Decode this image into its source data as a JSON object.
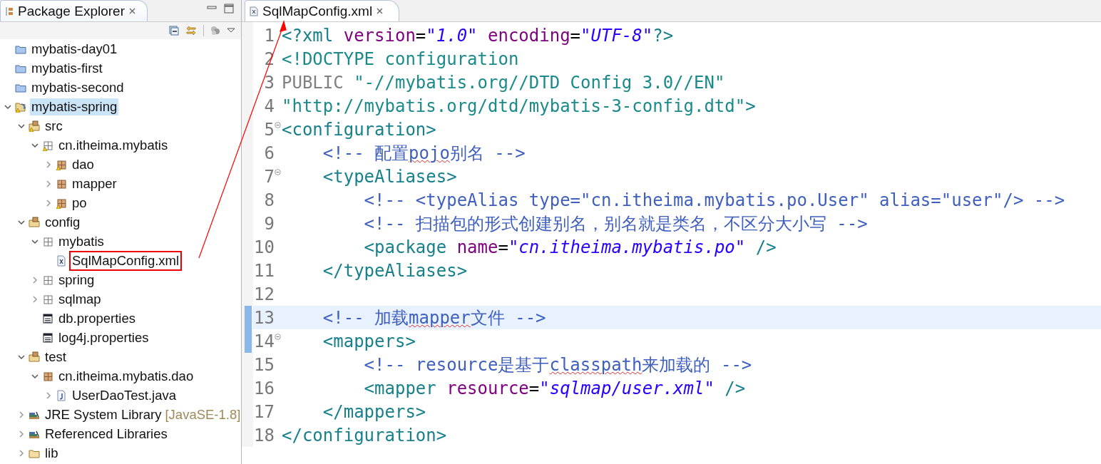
{
  "explorer": {
    "title": "Package Explorer",
    "tree": [
      {
        "label": "mybatis-day01",
        "kind": "project_closed"
      },
      {
        "label": "mybatis-first",
        "kind": "project_closed"
      },
      {
        "label": "mybatis-second",
        "kind": "project_closed"
      },
      {
        "label": "mybatis-spring",
        "kind": "project_open",
        "warning": true,
        "selected": true,
        "expanded": true,
        "children": [
          {
            "label": "src",
            "kind": "source_folder",
            "warning": true,
            "expanded": true,
            "children": [
              {
                "label": "cn.itheima.mybatis",
                "kind": "package_empty",
                "warning": true,
                "expanded": true,
                "children": [
                  {
                    "label": "dao",
                    "kind": "package",
                    "warning": true,
                    "expanded": false
                  },
                  {
                    "label": "mapper",
                    "kind": "package",
                    "expanded": false
                  },
                  {
                    "label": "po",
                    "kind": "package",
                    "warning": true,
                    "expanded": false
                  }
                ]
              }
            ]
          },
          {
            "label": "config",
            "kind": "source_folder",
            "expanded": true,
            "children": [
              {
                "label": "mybatis",
                "kind": "package_empty",
                "expanded": true,
                "children": [
                  {
                    "label": "SqlMapConfig.xml",
                    "kind": "file_xml",
                    "annotated": true
                  }
                ]
              },
              {
                "label": "spring",
                "kind": "package_empty",
                "expanded": false
              },
              {
                "label": "sqlmap",
                "kind": "package_empty",
                "expanded": false
              },
              {
                "label": "db.properties",
                "kind": "file_properties"
              },
              {
                "label": "log4j.properties",
                "kind": "file_properties"
              }
            ]
          },
          {
            "label": "test",
            "kind": "source_folder",
            "expanded": true,
            "children": [
              {
                "label": "cn.itheima.mybatis.dao",
                "kind": "package",
                "expanded": true,
                "children": [
                  {
                    "label": "UserDaoTest.java",
                    "kind": "file_java",
                    "expanded": false
                  }
                ]
              }
            ]
          },
          {
            "label": "JRE System Library",
            "decoration": "[JavaSE-1.8]",
            "kind": "library",
            "expanded": false
          },
          {
            "label": "Referenced Libraries",
            "kind": "library",
            "expanded": false
          },
          {
            "label": "lib",
            "kind": "folder",
            "expanded": false
          }
        ]
      }
    ]
  },
  "editor": {
    "tab": {
      "title": "SqlMapConfig.xml",
      "selected": true
    },
    "lines": [
      {
        "number": "1",
        "tokens": [
          {
            "kind": "tag",
            "text": "<?xml "
          },
          {
            "kind": "attr",
            "text": "version"
          },
          {
            "kind": "plain",
            "text": "="
          },
          {
            "kind": "value",
            "text": "\"1.0\""
          },
          {
            "kind": "attr",
            "text": " encoding"
          },
          {
            "kind": "plain",
            "text": "="
          },
          {
            "kind": "value",
            "text": "\"UTF-8\""
          },
          {
            "kind": "tag",
            "text": "?>"
          }
        ]
      },
      {
        "number": "2",
        "tokens": [
          {
            "kind": "doctype",
            "text": "<!DOCTYPE configuration"
          }
        ]
      },
      {
        "number": "3",
        "tokens": [
          {
            "kind": "keyword",
            "text": "PUBLIC "
          },
          {
            "kind": "doctype",
            "text": "\"-//mybatis.org//DTD Config 3.0//EN\""
          }
        ]
      },
      {
        "number": "4",
        "tokens": [
          {
            "kind": "doctype",
            "text": "\"http://mybatis.org/dtd/mybatis-3-config.dtd\""
          },
          {
            "kind": "tag",
            "text": ">"
          }
        ]
      },
      {
        "number": "5",
        "fold": true,
        "tokens": [
          {
            "kind": "tag",
            "text": "<configuration>"
          }
        ]
      },
      {
        "number": "6",
        "tokens": [
          {
            "kind": "comment",
            "text": "    <!-- 配置"
          },
          {
            "kind": "typo",
            "text": "pojo"
          },
          {
            "kind": "comment",
            "text": "别名 -->"
          }
        ]
      },
      {
        "number": "7",
        "fold": true,
        "tokens": [
          {
            "kind": "tag",
            "text": "    <typeAliases>"
          }
        ]
      },
      {
        "number": "8",
        "tokens": [
          {
            "kind": "comment",
            "text": "        <!-- <typeAlias type=\"cn.itheima.mybatis.po.User\" alias=\"user\"/> -->"
          }
        ]
      },
      {
        "number": "9",
        "tokens": [
          {
            "kind": "comment",
            "text": "        <!-- 扫描包的形式创建别名，别名就是类名，不区分大小写 -->"
          }
        ]
      },
      {
        "number": "10",
        "tokens": [
          {
            "kind": "tag",
            "text": "        <package "
          },
          {
            "kind": "attr",
            "text": "name"
          },
          {
            "kind": "plain",
            "text": "="
          },
          {
            "kind": "value",
            "text": "\"cn.itheima.mybatis.po\""
          },
          {
            "kind": "tag",
            "text": " />"
          }
        ]
      },
      {
        "number": "11",
        "tokens": [
          {
            "kind": "tag",
            "text": "    </typeAliases>"
          }
        ]
      },
      {
        "number": "12"
      },
      {
        "number": "13",
        "current": true,
        "changed": true,
        "tokens": [
          {
            "kind": "comment",
            "text": "    <!-- 加载"
          },
          {
            "kind": "typo",
            "text": "mapper"
          },
          {
            "kind": "comment",
            "text": "文件 -->"
          }
        ]
      },
      {
        "number": "14",
        "fold": true,
        "changed": true,
        "tokens": [
          {
            "kind": "tag",
            "text": "    <mappers>"
          }
        ]
      },
      {
        "number": "15",
        "tokens": [
          {
            "kind": "comment",
            "text": "        <!-- resource是基于"
          },
          {
            "kind": "typo",
            "text": "classpath"
          },
          {
            "kind": "comment",
            "text": "来加载的 -->"
          }
        ]
      },
      {
        "number": "16",
        "tokens": [
          {
            "kind": "tag",
            "text": "        <mapper "
          },
          {
            "kind": "attr",
            "text": "resource"
          },
          {
            "kind": "plain",
            "text": "="
          },
          {
            "kind": "value",
            "text": "\"sqlmap/user.xml\""
          },
          {
            "kind": "tag",
            "text": " />"
          }
        ]
      },
      {
        "number": "17",
        "tokens": [
          {
            "kind": "tag",
            "text": "    </mappers>"
          }
        ]
      },
      {
        "number": "18",
        "tokens": [
          {
            "kind": "tag",
            "text": "</configuration>"
          }
        ]
      }
    ]
  }
}
